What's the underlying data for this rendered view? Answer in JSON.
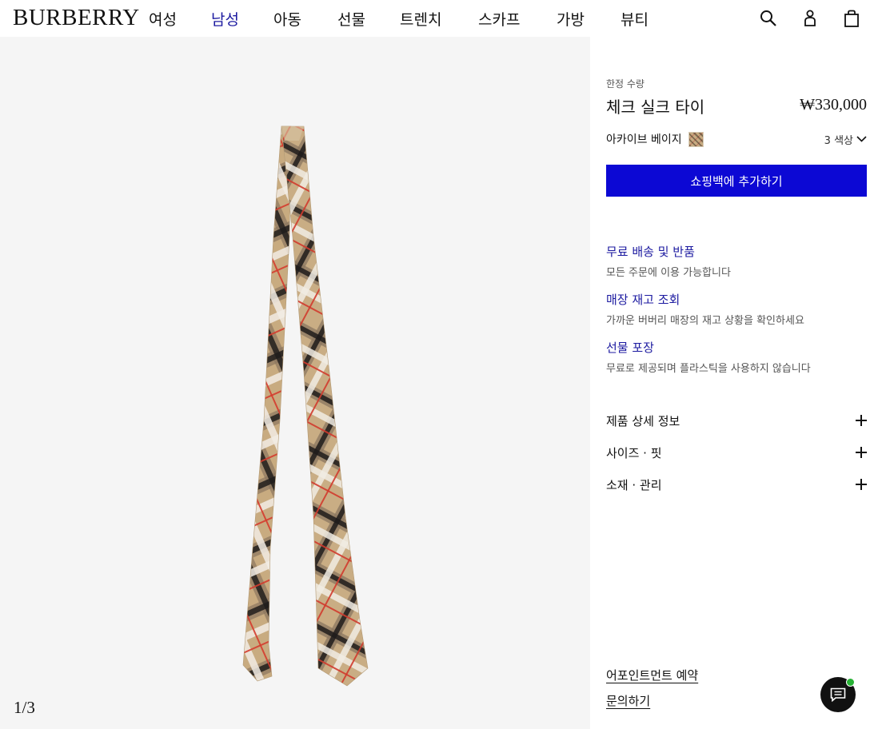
{
  "header": {
    "logo": "BURBERRY",
    "nav": [
      "여성",
      "남성",
      "아동",
      "선물",
      "트렌치",
      "스카프",
      "가방",
      "뷰티"
    ],
    "active_nav": "남성",
    "icons": [
      "search-icon",
      "account-icon",
      "bag-icon"
    ]
  },
  "gallery": {
    "counter": "1/3",
    "image": "check-silk-tie"
  },
  "product": {
    "badge": "한정 수량",
    "title": "체크 실크 타이",
    "price": "₩330,000",
    "color_name": "아카이브 베이지",
    "color_count": "3 색상",
    "add_to_bag": "쇼핑백에 추가하기"
  },
  "services": [
    {
      "title": "무료 배송 및 반품",
      "desc": "모든 주문에 이용 가능합니다"
    },
    {
      "title": "매장 재고 조회",
      "desc": "가까운 버버리 매장의 재고 상황을 확인하세요"
    },
    {
      "title": "선물 포장",
      "desc": "무료로 제공되며 플라스틱을 사용하지 않습니다"
    }
  ],
  "accordions": [
    "제품 상세 정보",
    "사이즈 · 핏",
    "소재 · 관리"
  ],
  "footer_links": [
    "어포인트먼트 예약",
    "문의하기"
  ],
  "colors": {
    "accent_blue": "#0c08d4",
    "link_blue": "#1c1aa0",
    "gallery_bg": "#f5f5f5",
    "chat_dot": "#27b135"
  }
}
